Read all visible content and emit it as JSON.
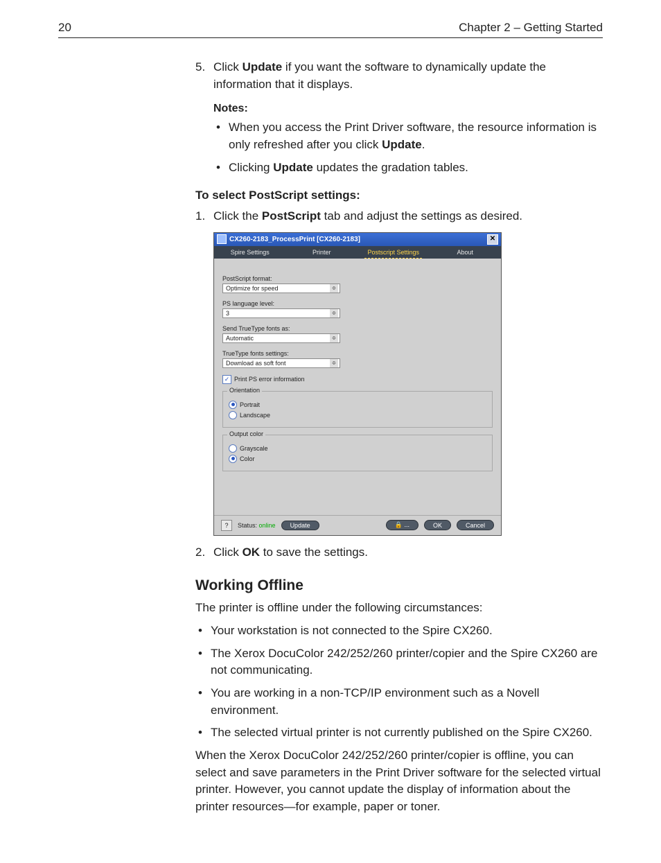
{
  "header": {
    "page_number": "20",
    "chapter": "Chapter 2 – Getting Started"
  },
  "step5": {
    "num": "5.",
    "pre": "Click ",
    "bold": "Update",
    "post": " if you want the software to dynamically update the information that it displays."
  },
  "notes": {
    "label": "Notes:",
    "items": [
      {
        "pre": "When you access the Print Driver software, the resource information is only refreshed after you click ",
        "bold": "Update",
        "post": "."
      },
      {
        "pre": "Clicking ",
        "bold": "Update",
        "post": " updates the gradation tables."
      }
    ]
  },
  "ps_heading": "To select PostScript settings:",
  "ps_step1": {
    "num": "1.",
    "pre": "Click the ",
    "bold": "PostScript",
    "post": " tab and adjust the settings as desired."
  },
  "dialog": {
    "title": "CX260-2183_ProcessPrint [CX260-2183]",
    "close": "✕",
    "tabs": {
      "spire": "Spire Settings",
      "printer": "Printer",
      "ps": "Postscript Settings",
      "about": "About"
    },
    "fields": {
      "fmt": {
        "label": "PostScript format:",
        "value": "Optimize for speed"
      },
      "lvl": {
        "label": "PS language level:",
        "value": "3"
      },
      "tt": {
        "label": "Send TrueType fonts as:",
        "value": "Automatic"
      },
      "tts": {
        "label": "TrueType fonts settings:",
        "value": "Download as soft font"
      }
    },
    "checkbox": {
      "label": "Print PS error information",
      "mark": "✓"
    },
    "orientation": {
      "legend": "Orientation",
      "portrait": "Portrait",
      "landscape": "Landscape"
    },
    "output": {
      "legend": "Output color",
      "gray": "Grayscale",
      "color": "Color"
    },
    "footer": {
      "q": "?",
      "status_label": "Status:",
      "status_value": "online",
      "update": "Update",
      "lock": "🔒 ...",
      "ok": "OK",
      "cancel": "Cancel"
    }
  },
  "step2": {
    "num": "2.",
    "pre": "Click ",
    "bold": "OK",
    "post": " to save the settings."
  },
  "offline": {
    "heading": "Working Offline",
    "intro": "The printer is offline under the following circumstances:",
    "bullets": [
      "Your workstation is not connected to the Spire CX260.",
      "The Xerox DocuColor 242/252/260 printer/copier and the Spire CX260 are not communicating.",
      "You are working in a non-TCP/IP environment such as a Novell environment.",
      "The selected virtual printer is not currently published on the Spire CX260."
    ],
    "para": "When the Xerox DocuColor 242/252/260 printer/copier is offline, you can select and save parameters in the Print Driver software for the selected virtual printer. However, you cannot update the display of information about the printer resources—for example, paper or toner."
  }
}
